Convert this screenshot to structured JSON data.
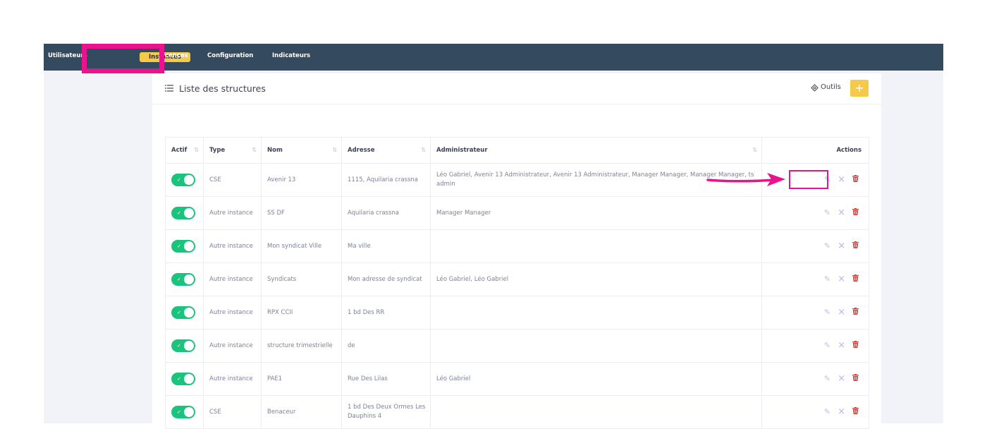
{
  "nav": {
    "items": [
      "Utilisateurs",
      "Instances",
      "cences",
      "Configuration",
      "Indicateurs"
    ],
    "active": "Instances"
  },
  "page": {
    "title": "Liste des structures",
    "tools_label": "Outils",
    "add_label": "+"
  },
  "table": {
    "columns": [
      "Actif",
      "Type",
      "Nom",
      "Adresse",
      "Administrateur",
      "Actions"
    ],
    "rows": [
      {
        "type": "CSE",
        "nom": "Avenir 13",
        "adresse": "1115, Aquilaria crassna",
        "admin": "Léo Gabriel, Avenir 13 Administrateur, Avenir 13 Administrateur, Manager Manager, Manager Manager, ts admin"
      },
      {
        "type": "Autre instance",
        "nom": "SS DF",
        "adresse": "Aquilaria crassna",
        "admin": "Manager Manager"
      },
      {
        "type": "Autre instance",
        "nom": "Mon syndicat Ville",
        "adresse": "Ma ville",
        "admin": ""
      },
      {
        "type": "Autre instance",
        "nom": "Syndicats",
        "adresse": "Mon adresse de syndicat",
        "admin": "Léo Gabriel, Léo Gabriel"
      },
      {
        "type": "Autre instance",
        "nom": "RPX CCII",
        "adresse": "1 bd Des RR",
        "admin": ""
      },
      {
        "type": "Autre instance",
        "nom": "structure trimestrielle",
        "adresse": "de",
        "admin": ""
      },
      {
        "type": "Autre instance",
        "nom": "PAE1",
        "adresse": "Rue Des Lilas",
        "admin": "Léo Gabriel"
      },
      {
        "type": "CSE",
        "nom": "Benaceur",
        "adresse": "1 bd Des Deux Ormes Les Dauphins 4",
        "admin": ""
      }
    ]
  },
  "colors": {
    "navbar": "#344a5e",
    "active_tab": "#f7c948",
    "toggle_on": "#1bc47d",
    "delete": "#e03c31",
    "annotation": "#e8148e"
  },
  "icons": {
    "list": "list-icon",
    "tools": "tools-icon",
    "edit": "edit-icon",
    "unlink": "close-icon",
    "delete": "trash-icon"
  }
}
